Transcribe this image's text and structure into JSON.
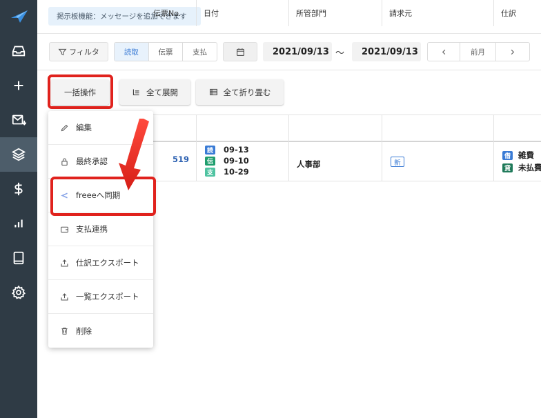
{
  "notice": "掲示板機能：メッセージを追加できます",
  "toolbar": {
    "filter_label": "フィルタ",
    "segments": [
      "読取",
      "伝票",
      "支払"
    ],
    "date_from": "2021/09/13",
    "tilde": "〜",
    "date_to": "2021/09/13",
    "prev_month": "前月"
  },
  "actions": {
    "bulk": "一括操作",
    "expand_all": "全て展開",
    "collapse_all": "全て折り畳む"
  },
  "table": {
    "headers": [
      "伝票No.",
      "日付",
      "所管部門",
      "請求元",
      "仕訳"
    ],
    "row": {
      "number": "519",
      "dates": [
        {
          "tag": "読",
          "date": "09-13",
          "color": "#3a7bd5"
        },
        {
          "tag": "伝",
          "date": "09-10",
          "color": "#1f9e6e"
        },
        {
          "tag": "支",
          "date": "10-29",
          "color": "#4fc3a1"
        }
      ],
      "department": "人事部",
      "biller_badge": "新",
      "journal": [
        {
          "tag": "借",
          "account": "雑費",
          "color": "#3a7bd5"
        },
        {
          "tag": "貸",
          "account": "未払費",
          "color": "#1f7a5a"
        }
      ]
    }
  },
  "menu": {
    "items": [
      {
        "label": "編集",
        "icon": "pencil-icon"
      },
      {
        "label": "最終承認",
        "icon": "lock-icon"
      },
      {
        "label": "freeeへ同期",
        "icon": "freee-icon"
      },
      {
        "label": "支払連携",
        "icon": "wallet-icon"
      },
      {
        "label": "仕訳エクスポート",
        "icon": "upload-icon"
      },
      {
        "label": "一覧エクスポート",
        "icon": "upload-icon"
      },
      {
        "label": "削除",
        "icon": "trash-icon"
      }
    ]
  },
  "colors": {
    "sidebar": "#2f3b45",
    "highlight": "#e0221d",
    "accent": "#3a7bd5"
  }
}
